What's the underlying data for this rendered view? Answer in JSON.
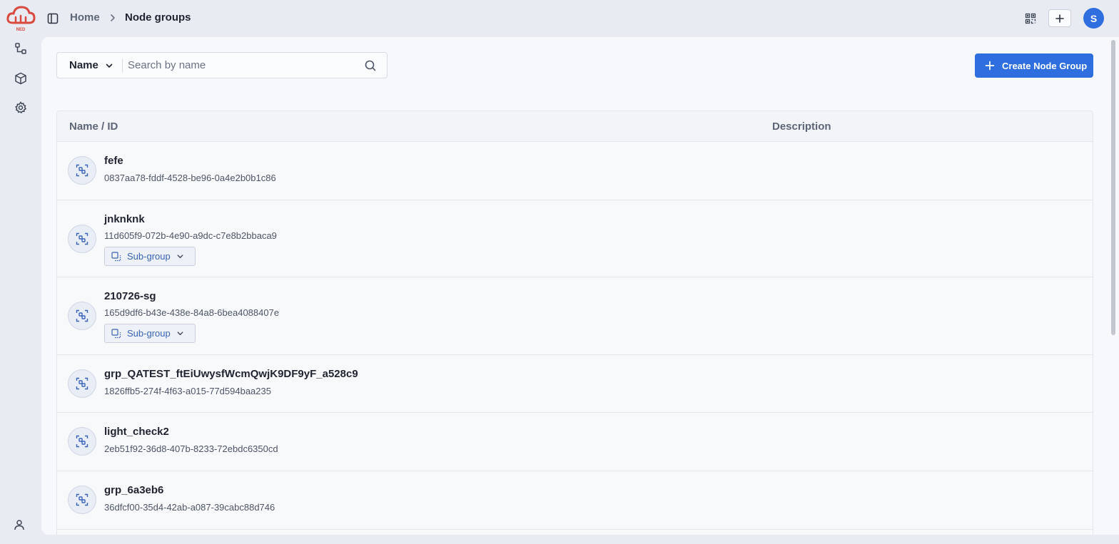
{
  "app": {
    "logo_text": "NED"
  },
  "breadcrumb": {
    "home": "Home",
    "current": "Node groups"
  },
  "user": {
    "avatar_initial": "S"
  },
  "search": {
    "field": "Name",
    "placeholder": "Search by name",
    "value": ""
  },
  "actions": {
    "create_label": "Create Node Group"
  },
  "table": {
    "columns": [
      "Name / ID",
      "Description"
    ],
    "rows": [
      {
        "name": "fefe",
        "id": "0837aa78-fddf-4528-be96-0a4e2b0b1c86",
        "description": "",
        "badge": ""
      },
      {
        "name": "jnknknk",
        "id": "11d605f9-072b-4e90-a9dc-c7e8b2bbaca9",
        "description": "",
        "badge": "Sub-group"
      },
      {
        "name": "210726-sg",
        "id": "165d9df6-b43e-438e-84a8-6bea4088407e",
        "description": "",
        "badge": "Sub-group"
      },
      {
        "name": "grp_QATEST_ftEiUwysfWcmQwjK9DF9yF_a528c9",
        "id": "1826ffb5-274f-4f63-a015-77d594baa235",
        "description": "",
        "badge": ""
      },
      {
        "name": "light_check2",
        "id": "2eb51f92-36d8-407b-8233-72ebdc6350cd",
        "description": "",
        "badge": ""
      },
      {
        "name": "grp_6a3eb6",
        "id": "36dfcf00-35d4-42ab-a087-39cabc88d746",
        "description": "",
        "badge": ""
      }
    ]
  },
  "colors": {
    "accent": "#2f6ede",
    "background": "#e8ebf2",
    "panel": "#f7f8fb"
  }
}
